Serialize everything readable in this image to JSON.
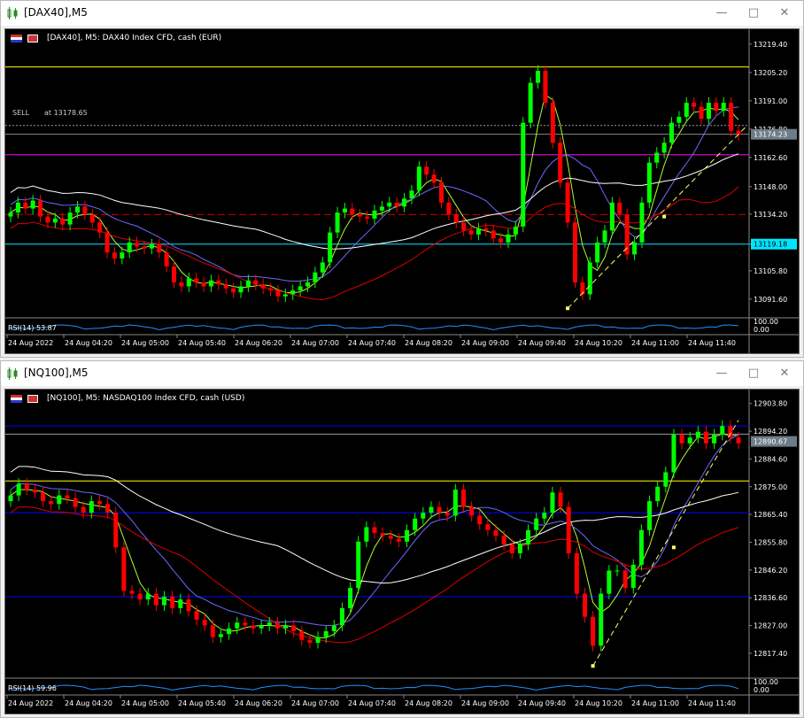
{
  "windows": [
    {
      "title": "[DAX40],M5",
      "header": "[DAX40], M5:  DAX40 Index CFD, cash (EUR)",
      "price_labels": [
        "13219.40",
        "13205.20",
        "13191.00",
        "13176.80",
        "13162.60",
        "13148.00",
        "13134.20",
        "13119.18",
        "13105.80",
        "13091.60"
      ],
      "current_price": "13174.23",
      "hline_price": "13119.18",
      "sell_label": "SELL",
      "sell_price": "at 13178.65",
      "rsi_label": "RSI(14) 53.87",
      "rsi_scale": [
        "100.00",
        "0.00"
      ],
      "time_labels": [
        "24 Aug 2022",
        "24 Aug 04:20",
        "24 Aug 05:00",
        "24 Aug 05:40",
        "24 Aug 06:20",
        "24 Aug 07:00",
        "24 Aug 07:40",
        "24 Aug 08:20",
        "24 Aug 09:00",
        "24 Aug 09:40",
        "24 Aug 10:20",
        "24 Aug 11:00",
        "24 Aug 11:40"
      ]
    },
    {
      "title": "[NQ100],M5",
      "header": "[NQ100], M5:  NASDAQ100 Index CFD, cash (USD)",
      "price_labels": [
        "12903.80",
        "12894.20",
        "12884.60",
        "12875.00",
        "12865.40",
        "12855.80",
        "12846.20",
        "12836.60",
        "12827.00",
        "12817.40"
      ],
      "current_price": "12890.67",
      "rsi_label": "RSI(14) 59.96",
      "rsi_scale": [
        "100.00",
        "0.00"
      ],
      "time_labels": [
        "24 Aug 2022",
        "24 Aug 04:20",
        "24 Aug 05:00",
        "24 Aug 05:40",
        "24 Aug 06:20",
        "24 Aug 07:00",
        "24 Aug 07:40",
        "24 Aug 08:20",
        "24 Aug 09:00",
        "24 Aug 09:40",
        "24 Aug 10:20",
        "24 Aug 11:00",
        "24 Aug 11:40"
      ]
    }
  ],
  "colors": {
    "bull": "#00ff00",
    "bear": "#ff0000",
    "ma_fast": "#adff2f",
    "ma_mid": "#6a6aff",
    "ma_slow": "#ffffff",
    "ma_red": "#dd0000",
    "trend": "#ffff66",
    "resistance": "#ffff00",
    "support_cyan": "#00e5ff",
    "magenta": "#ff00ff",
    "blue_line": "#0000ff"
  },
  "chart_data": [
    {
      "type": "candlestick",
      "symbol": "DAX40",
      "timeframe": "M5",
      "ylim": [
        13084,
        13226
      ],
      "bars": []
    },
    {
      "type": "candlestick",
      "symbol": "NQ100",
      "timeframe": "M5",
      "ylim": [
        12810,
        12908
      ],
      "bars": []
    }
  ]
}
